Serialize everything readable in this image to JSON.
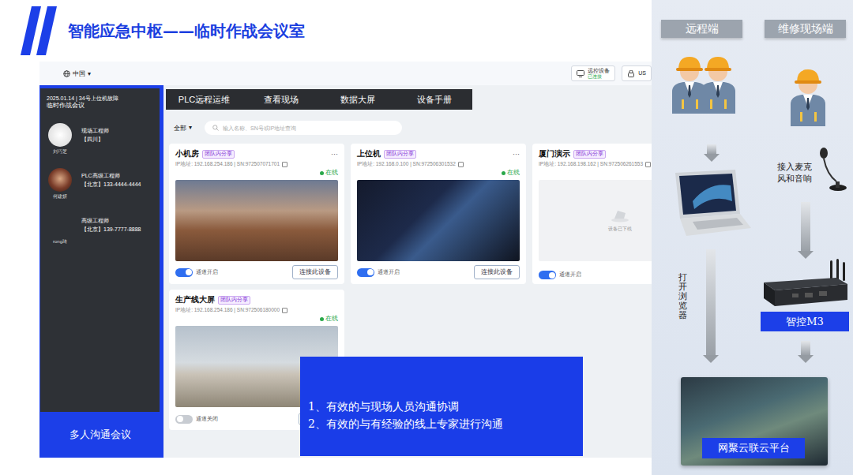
{
  "slide": {
    "title": "智能应急中枢——临时作战会议室"
  },
  "app": {
    "region": {
      "label": "中国",
      "caret": "▾"
    },
    "status_chips": [
      {
        "label": "远控设备",
        "sub": "已连接"
      },
      {
        "label": "US"
      }
    ],
    "meeting": {
      "header_line": "2025.01.14 | 34号上位机故障",
      "title": "临时作战会议",
      "participants": [
        {
          "name": "刘巧芝",
          "role": "现场工程师",
          "detail": "【四川】"
        },
        {
          "name": "何建妍",
          "role": "PLC高级工程师",
          "detail": "【北京】133-4444-4444"
        },
        {
          "name": "rong琦",
          "role": "高级工程师",
          "detail": "【北京】139-7777-8888"
        }
      ],
      "footer": "多人沟通会议"
    },
    "tabs": [
      {
        "label": "PLC远程运维"
      },
      {
        "label": "查看现场"
      },
      {
        "label": "数据大屏"
      },
      {
        "label": "设备手册"
      }
    ],
    "filter": {
      "label": "全部",
      "caret": "▾"
    },
    "search": {
      "placeholder": "输入名称、SN号或IP地址查询"
    },
    "cards": [
      {
        "name": "小机房",
        "badge": "团队内分享",
        "more": "···",
        "ip": "IP地址: 192.168.254.186 | SN:972507071701",
        "status": "在线",
        "image": "photo-desert",
        "channel_on": true,
        "channel_label": "通道开启",
        "button": "连接此设备"
      },
      {
        "name": "上位机",
        "badge": "团队内分享",
        "more": "···",
        "ip": "IP地址: 192.168.0.100 | SN:972506301532",
        "status": "在线",
        "image": "screen",
        "channel_on": true,
        "channel_label": "通道开启",
        "button": "连接此设备"
      },
      {
        "name": "厦门演示",
        "badge": "团队内分享",
        "ip": "IP地址: 192.168.198.162 | SN:972506261553",
        "image": "offline",
        "offline_text": "设备已下线",
        "channel_on": true,
        "channel_label": "通道开启"
      },
      {
        "name": "生产线大屏",
        "badge": "团队内分享",
        "ip": "IP地址: 192.168.254.186 | SN:972506180000",
        "status": "在线",
        "image": "photo-field",
        "channel_on": false,
        "channel_label": "通道关闭"
      }
    ]
  },
  "callout": {
    "lines": [
      "1、有效的与现场人员沟通协调",
      "2、有效的与有经验的线上专家进行沟通"
    ]
  },
  "diagram": {
    "remote_label": "远程端",
    "site_label": "维修现场端",
    "mic_label": "接入麦克风和音响",
    "browser_label": "打开浏览器",
    "device_label": "智控M3",
    "platform_label": "网聚云联云平台"
  }
}
